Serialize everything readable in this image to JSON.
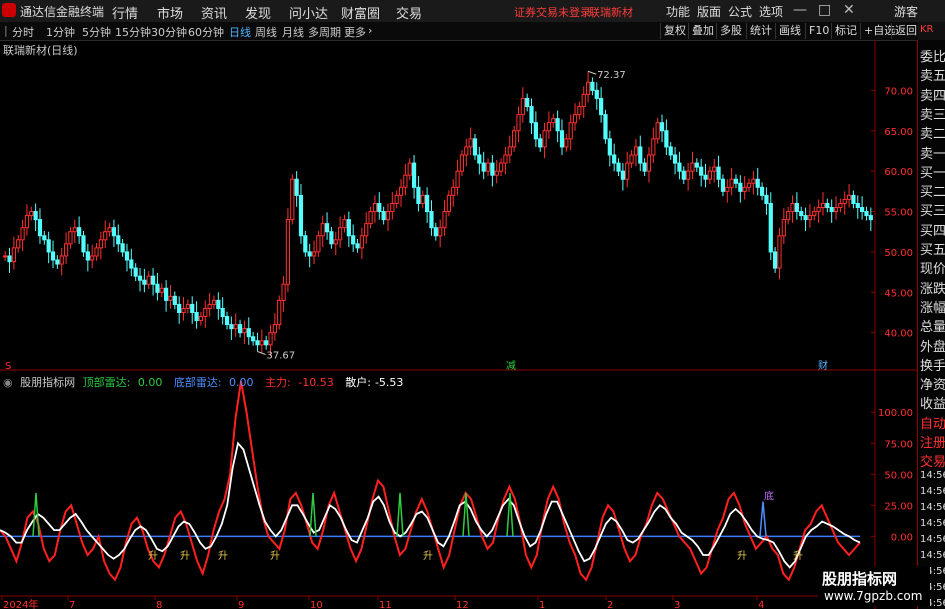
{
  "topbar": {
    "app_title": "通达信金融终端",
    "menu": [
      "行情",
      "市场",
      "资讯",
      "发现",
      "问小达",
      "财富圈",
      "交易"
    ],
    "status": "证券交易未登录",
    "stock_name": "联瑞新材",
    "right_menu": [
      "功能",
      "版面",
      "公式",
      "选项"
    ],
    "guest": "游客"
  },
  "subbar": {
    "timeframes": [
      "分时",
      "1分钟",
      "5分钟",
      "15分钟",
      "30分钟",
      "60分钟",
      "日线",
      "周线",
      "月线",
      "多周期",
      "更多"
    ],
    "active": "日线",
    "buttons": [
      "复权",
      "叠加",
      "多股",
      "统计",
      "画线",
      "F10",
      "标记",
      "+自选",
      "返回"
    ]
  },
  "main_chart": {
    "title": "联瑞新材(日线)",
    "high_label": "72.37",
    "low_label": "37.67",
    "markers": [
      "S",
      "减",
      "财"
    ]
  },
  "indicator": {
    "title": "股朋指标网",
    "items": [
      {
        "label": "顶部雷达:",
        "value": "0.00",
        "color": "#2ecc40"
      },
      {
        "label": "底部雷达:",
        "value": "0.00",
        "color": "#4f8fff"
      },
      {
        "label": "主力:",
        "value": "-10.53",
        "color": "#ff3030"
      },
      {
        "label": "散户:",
        "value": "-5.53",
        "color": "#ffffff"
      }
    ],
    "signals": [
      "升",
      "升",
      "升",
      "升",
      "升",
      "升",
      "升",
      "底"
    ]
  },
  "right_panel": {
    "header": "KR",
    "items": [
      "委比",
      "卖五",
      "卖四",
      "卖三",
      "卖二",
      "卖一",
      "买一",
      "买二",
      "买三",
      "买四",
      "买五",
      "现价",
      "涨跌",
      "涨幅",
      "总量",
      "外盘",
      "换手",
      "净资",
      "收益",
      "自动",
      "注册",
      "交易"
    ],
    "times": [
      "14:56",
      "14:56",
      "14:56",
      "14:56",
      "14:56",
      "14:56",
      "14:56",
      "14:56",
      "14:56"
    ]
  },
  "watermark": {
    "line1": "股朋指标网",
    "line2": "www.7gpzb.com"
  },
  "chart_data": [
    {
      "type": "candlestick",
      "title": "联瑞新材(日线)",
      "ylim": [
        36,
        75
      ],
      "yticks": [
        40.0,
        45.0,
        50.0,
        55.0,
        60.0,
        65.0,
        70.0
      ],
      "x_labels": [
        "2024年",
        "7",
        "8",
        "9",
        "10",
        "11",
        "12",
        "1",
        "2",
        "3",
        "4"
      ],
      "closes": [
        49.5,
        48.8,
        50.5,
        51.5,
        53,
        54.5,
        55,
        54,
        52,
        51.5,
        50,
        49,
        48.5,
        49.5,
        51,
        52.5,
        53,
        52,
        50,
        49,
        49.5,
        50.5,
        51.5,
        52.5,
        53,
        52,
        51,
        50,
        49,
        48,
        47,
        46.5,
        46,
        47,
        46,
        45,
        45.5,
        44,
        44.5,
        43.5,
        42.5,
        43,
        43.5,
        42.5,
        41.5,
        42,
        43,
        43.5,
        44,
        43,
        42,
        41,
        40.5,
        41,
        40,
        40.5,
        39.5,
        39,
        38.5,
        39,
        38.5,
        40,
        41,
        44,
        46,
        54,
        59,
        57,
        52,
        50,
        49.5,
        50,
        52,
        53.5,
        52.5,
        51,
        51.5,
        53,
        54,
        52,
        51,
        50.5,
        52,
        53.5,
        55,
        56,
        55,
        54,
        55,
        56,
        57,
        58,
        59.5,
        61,
        58,
        56,
        57,
        55,
        53,
        52,
        53,
        55,
        57,
        58,
        60,
        62,
        63,
        64,
        62,
        61,
        60,
        61,
        59.5,
        60,
        61,
        62,
        63,
        65,
        67,
        69,
        68,
        66,
        64,
        63,
        65,
        66,
        66.5,
        65,
        63,
        64,
        66,
        67,
        68,
        69.5,
        71,
        70,
        69,
        67,
        64,
        62,
        61,
        60,
        59,
        61,
        62,
        63,
        61,
        60,
        62,
        64,
        66,
        65,
        63,
        62,
        61,
        60,
        59,
        60,
        61,
        60.5,
        59.5,
        59,
        60,
        60.5,
        59,
        57.5,
        58,
        59,
        58.5,
        57.5,
        58,
        58.5,
        59,
        58,
        57,
        56,
        50,
        48,
        52,
        54,
        55,
        56,
        55,
        54.5,
        54,
        54.5,
        55,
        55.5,
        56,
        55.5,
        55,
        55.5,
        56,
        56.5,
        57,
        56,
        55.5,
        55,
        54.5,
        54
      ],
      "high": 72.37,
      "low": 37.67
    },
    {
      "type": "line",
      "title": "股朋指标网",
      "ylim": [
        -40,
        130
      ],
      "yticks": [
        0.0,
        25.0,
        50.0,
        75.0,
        100.0
      ],
      "series": [
        {
          "name": "主力",
          "values": [
            5,
            0,
            -10,
            -20,
            -5,
            15,
            20,
            10,
            -10,
            -20,
            -15,
            5,
            20,
            25,
            10,
            -5,
            -15,
            -10,
            0,
            -20,
            -30,
            -35,
            -25,
            -5,
            10,
            15,
            5,
            -10,
            -20,
            -25,
            -15,
            0,
            15,
            20,
            10,
            -5,
            -20,
            -30,
            -15,
            5,
            20,
            30,
            50,
            95,
            125,
            100,
            70,
            40,
            15,
            0,
            -5,
            -10,
            5,
            30,
            35,
            25,
            10,
            -5,
            -10,
            5,
            25,
            35,
            20,
            5,
            -10,
            -20,
            -10,
            10,
            30,
            45,
            40,
            20,
            0,
            -15,
            -10,
            5,
            20,
            30,
            20,
            5,
            -10,
            -25,
            -15,
            5,
            25,
            35,
            30,
            15,
            0,
            -10,
            -5,
            15,
            30,
            40,
            30,
            10,
            -15,
            -25,
            -15,
            10,
            30,
            40,
            30,
            10,
            -5,
            -15,
            -30,
            -35,
            -25,
            -5,
            15,
            25,
            20,
            5,
            -10,
            -20,
            -15,
            0,
            10,
            25,
            35,
            30,
            20,
            10,
            0,
            -5,
            -10,
            -20,
            -30,
            -25,
            -10,
            5,
            15,
            30,
            35,
            25,
            10,
            0,
            -10,
            -5,
            0,
            -10,
            -15,
            -30,
            -35,
            -25,
            -10,
            5,
            10,
            20,
            25,
            15,
            5,
            -5,
            -10,
            -15,
            -10,
            -5
          ],
          "color": "#ff2020"
        },
        {
          "name": "散户",
          "values": [
            5,
            3,
            0,
            -5,
            -5,
            5,
            12,
            18,
            15,
            10,
            5,
            5,
            10,
            15,
            18,
            12,
            5,
            0,
            -5,
            -10,
            -15,
            -18,
            -15,
            -10,
            -2,
            5,
            8,
            5,
            -2,
            -10,
            -12,
            -8,
            0,
            8,
            12,
            10,
            3,
            -5,
            -10,
            -8,
            0,
            10,
            25,
            55,
            75,
            70,
            55,
            40,
            25,
            12,
            5,
            0,
            5,
            15,
            25,
            25,
            18,
            10,
            3,
            5,
            15,
            25,
            22,
            15,
            5,
            -3,
            -5,
            5,
            15,
            28,
            32,
            25,
            12,
            3,
            0,
            3,
            10,
            18,
            20,
            15,
            5,
            -5,
            -8,
            0,
            12,
            25,
            28,
            22,
            12,
            5,
            0,
            5,
            15,
            25,
            30,
            25,
            12,
            0,
            -8,
            -5,
            5,
            18,
            28,
            28,
            18,
            8,
            -2,
            -12,
            -20,
            -18,
            -10,
            0,
            10,
            15,
            12,
            5,
            -3,
            -5,
            -2,
            5,
            12,
            20,
            25,
            22,
            15,
            10,
            3,
            0,
            -3,
            -8,
            -15,
            -15,
            -8,
            0,
            8,
            18,
            22,
            18,
            12,
            5,
            0,
            -2,
            -3,
            -5,
            -12,
            -20,
            -25,
            -20,
            -10,
            0,
            5,
            8,
            12,
            10,
            8,
            5,
            2,
            0,
            -3,
            -5
          ],
          "color": "#ffffff"
        }
      ]
    }
  ]
}
